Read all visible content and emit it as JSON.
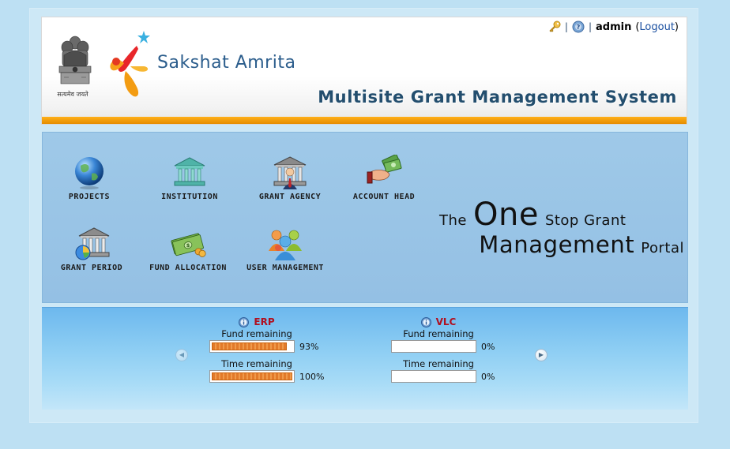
{
  "header": {
    "emblem_caption": "सत्यमेव जयते",
    "brand": "Sakshat Amrita",
    "system_title": "Multisite Grant Management System",
    "toplinks": {
      "separator": "|",
      "user": "admin",
      "logout_label": "Logout",
      "key_icon": "key-icon",
      "help_icon": "help-icon"
    }
  },
  "menu": {
    "items": [
      {
        "label": "PROJECTS",
        "icon": "globe-icon"
      },
      {
        "label": "INSTITUTION",
        "icon": "institution-building-icon"
      },
      {
        "label": "GRANT AGENCY",
        "icon": "grant-agency-icon"
      },
      {
        "label": "ACCOUNT HEAD",
        "icon": "money-hand-icon"
      },
      {
        "label": "GRANT PERIOD",
        "icon": "grant-period-icon"
      },
      {
        "label": "FUND ALLOCATION",
        "icon": "banknotes-coins-icon"
      },
      {
        "label": "USER MANAGEMENT",
        "icon": "users-group-icon"
      }
    ]
  },
  "tagline": {
    "the": "The",
    "one": "One",
    "stop_grant": "Stop Grant",
    "management": "Management",
    "portal": "Portal"
  },
  "status": {
    "projects": [
      {
        "name": "ERP",
        "fund_label": "Fund remaining",
        "fund_percent": 93,
        "fund_text": "93%",
        "time_label": "Time remaining",
        "time_percent": 100,
        "time_text": "100%"
      },
      {
        "name": "VLC",
        "fund_label": "Fund remaining",
        "fund_percent": 0,
        "fund_text": "0%",
        "time_label": "Time remaining",
        "time_percent": 0,
        "time_text": "0%"
      }
    ],
    "prev_icon": "left-arrow-icon",
    "next_icon": "right-arrow-icon"
  },
  "colors": {
    "accent_orange": "#f0a000",
    "title_blue": "#234e6e",
    "project_red": "#b01020",
    "panel_blue": "#9fc9e8"
  }
}
